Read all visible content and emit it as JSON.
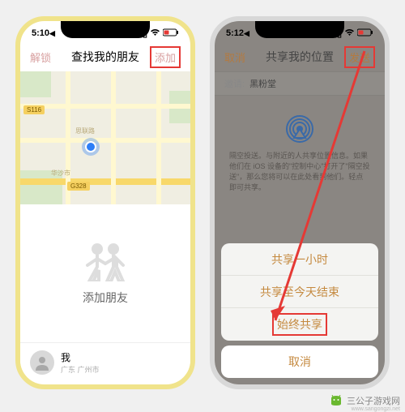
{
  "left": {
    "status": {
      "time": "5:10",
      "time_suffix": "◀"
    },
    "header": {
      "back": "解锁",
      "title": "查找我的朋友",
      "action": "添加"
    },
    "map": {
      "road1": "思联路",
      "city": "华沙市",
      "hwy1": "S116",
      "hwy2": "G328"
    },
    "empty": {
      "add_friend": "添加朋友"
    },
    "me": {
      "label": "我",
      "location": "广东 广州市"
    }
  },
  "right": {
    "status": {
      "time": "5:12",
      "time_suffix": "◀"
    },
    "header": {
      "cancel": "取消",
      "title": "共享我的位置",
      "send": "发送"
    },
    "invite": {
      "label": "邀请:",
      "name": "黑粉堂"
    },
    "airdrop": "隔空投送。与附近的人共享位置信息。如果他们在 iOS 设备的\"控制中心\"打开了\"隔空投送\"，那么您将可以在此处看到他们。轻点即可共享。",
    "sheet": {
      "opt1": "共享一小时",
      "opt2": "共享至今天结束",
      "opt3": "始终共享",
      "cancel": "取消"
    }
  },
  "watermark": {
    "brand": "三公子游戏网",
    "url": "www.sangongzi.net"
  }
}
